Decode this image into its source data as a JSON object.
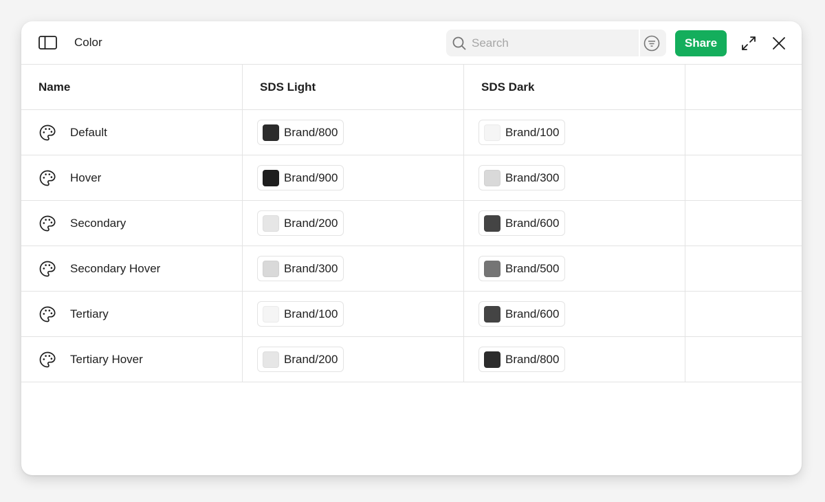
{
  "window": {
    "title": "Color"
  },
  "search": {
    "placeholder": "Search",
    "value": ""
  },
  "toolbar": {
    "share_label": "Share"
  },
  "table": {
    "columns": [
      "Name",
      "SDS Light",
      "SDS Dark",
      ""
    ],
    "rows": [
      {
        "name": "Default",
        "light": "Brand/800",
        "light_color": "#2c2c2c",
        "dark": "Brand/100",
        "dark_color": "#f5f5f5"
      },
      {
        "name": "Hover",
        "light": "Brand/900",
        "light_color": "#1e1e1e",
        "dark": "Brand/300",
        "dark_color": "#d9d9d9"
      },
      {
        "name": "Secondary",
        "light": "Brand/200",
        "light_color": "#e6e6e6",
        "dark": "Brand/600",
        "dark_color": "#444444"
      },
      {
        "name": "Secondary Hover",
        "light": "Brand/300",
        "light_color": "#d9d9d9",
        "dark": "Brand/500",
        "dark_color": "#757575"
      },
      {
        "name": "Tertiary",
        "light": "Brand/100",
        "light_color": "#f5f5f5",
        "dark": "Brand/600",
        "dark_color": "#444444"
      },
      {
        "name": "Tertiary Hover",
        "light": "Brand/200",
        "light_color": "#e6e6e6",
        "dark": "Brand/800",
        "dark_color": "#2c2c2c"
      }
    ]
  },
  "colors": {
    "accent": "#14ae5c",
    "border": "#e3e3e3",
    "background": "#f4f4f4"
  }
}
